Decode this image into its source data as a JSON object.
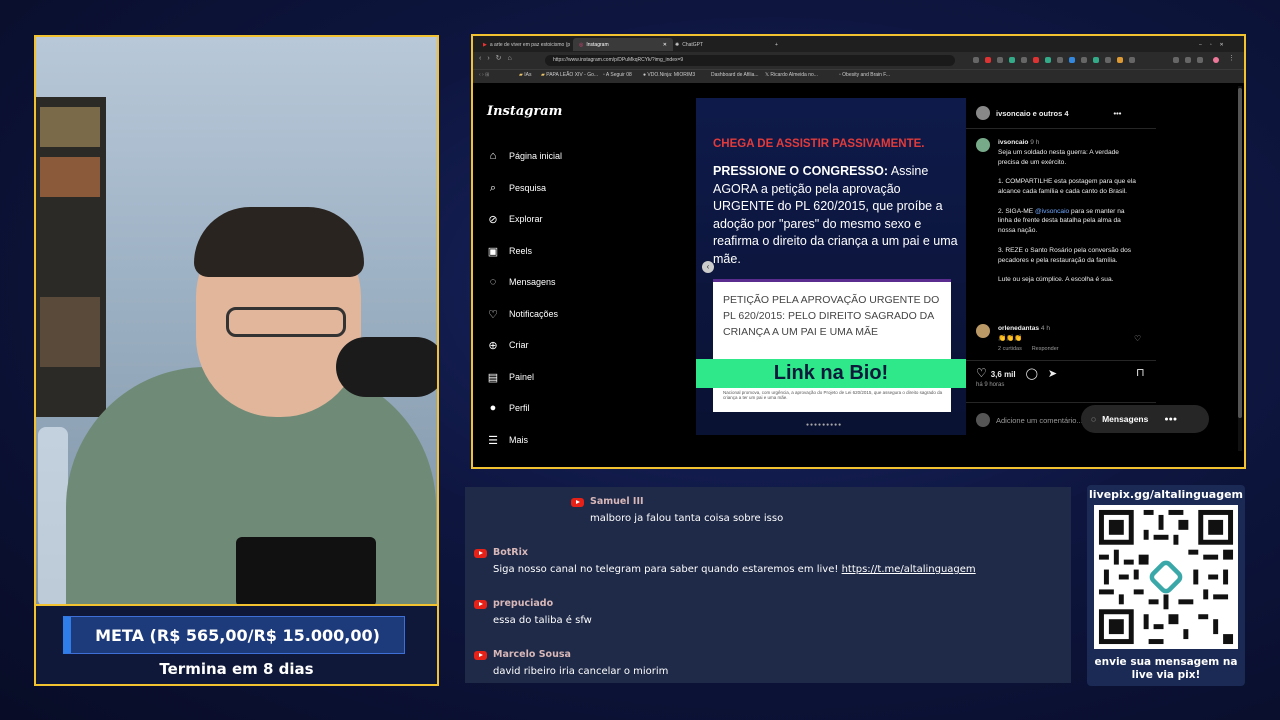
{
  "webcam": {
    "meta_label": "META (R$ 565,00/R$ 15.000,00)",
    "ends_label": "Termina em 8 dias"
  },
  "browser": {
    "tabs": [
      "a arte de viver em paz estoicismo (p",
      "Instagram",
      "ChatGPT"
    ],
    "url": "https://www.instagram.com/p/DPuMkqRCYk/?img_index=9",
    "bookmarks": [
      "IAs",
      "PAPA LEÃO XIV - Go...",
      "A Seguir 08",
      "VDO.Ninja: MIORIM3",
      "Dashboard de Afilia...",
      "Ricardo Almeida no...",
      "Obesity and Brain F..."
    ]
  },
  "instagram": {
    "logo": "Instagram",
    "nav": [
      {
        "label": "Página inicial",
        "icon": "home-icon"
      },
      {
        "label": "Pesquisa",
        "icon": "search-icon"
      },
      {
        "label": "Explorar",
        "icon": "compass-icon"
      },
      {
        "label": "Reels",
        "icon": "reels-icon"
      },
      {
        "label": "Mensagens",
        "icon": "messenger-icon"
      },
      {
        "label": "Notificações",
        "icon": "heart-icon"
      },
      {
        "label": "Criar",
        "icon": "plus-icon"
      },
      {
        "label": "Painel",
        "icon": "dashboard-icon"
      },
      {
        "label": "Perfil",
        "icon": "profile-icon"
      },
      {
        "label": "Mais",
        "icon": "menu-icon"
      }
    ],
    "post": {
      "headline": "CHEGA DE ASSISTIR PASSIVAMENTE.",
      "press_bold": "PRESSIONE O CONGRESSO:",
      "press_text": " Assine AGORA a petição pela aprovação URGENTE do PL 620/2015, que proíbe a adoção por \"pares\" do mesmo sexo e reafirma o direito da criança a um pai e uma mãe.",
      "petition_title": "PETIÇÃO PELA APROVAÇÃO URGENTE DO PL 620/2015: PELO DIREITO SAGRADO DA CRIANÇA A UM PAI E UMA MÃE",
      "petition_small": "Nacional promova, com urgência, a aprovação do Projeto de Lei 620/2015, que assegura o direito sagrado da criança a ter um pai e uma mãe.",
      "link_bio": "Link na Bio!"
    },
    "comments": {
      "header": "ivsoncaio e outros 4",
      "author": "ivsoncaio",
      "author_time": "9 h",
      "caption_1": "Seja um soldado nesta guerra: A verdade precisa de um exército.",
      "caption_2": "1. COMPARTILHE esta postagem para que ela alcance cada família e cada canto do Brasil.",
      "caption_3_pre": "2. SIGA-ME ",
      "caption_3_mention": "@ivsoncaio",
      "caption_3_post": " para se manter na linha de frente desta batalha pela alma da nossa nação.",
      "caption_4": "3. REZE o Santo Rosário pela conversão dos pecadores e pela restauração da família.",
      "caption_5": "Lute ou seja cúmplice. A escolha é sua.",
      "c2_author": "orlenedantas",
      "c2_time": "4 h",
      "c2_text": "👏👏👏",
      "c2_likes": "2 curtidas",
      "c2_reply": "Responder",
      "likes": "3,6 mil",
      "time_ago": "há 9 horas",
      "add_comment": "Adicione um comentário...",
      "messages_button": "Mensagens"
    }
  },
  "chat": [
    {
      "user": "Samuel III",
      "text": "malboro ja falou tanta coisa sobre isso"
    },
    {
      "user": "BotRix",
      "text": "Siga nosso canal no telegram para saber quando estaremos em live! ",
      "link": "https://t.me/altalinguagem"
    },
    {
      "user": "prepuciado",
      "text": "essa do taliba é sfw"
    },
    {
      "user": "Marcelo Sousa",
      "text": "david ribeiro iria cancelar o miorim"
    }
  ],
  "qr_panel": {
    "top": "livepix.gg/altalinguagem",
    "bottom_1": "envie sua mensagem na",
    "bottom_2": "live via pix!"
  }
}
